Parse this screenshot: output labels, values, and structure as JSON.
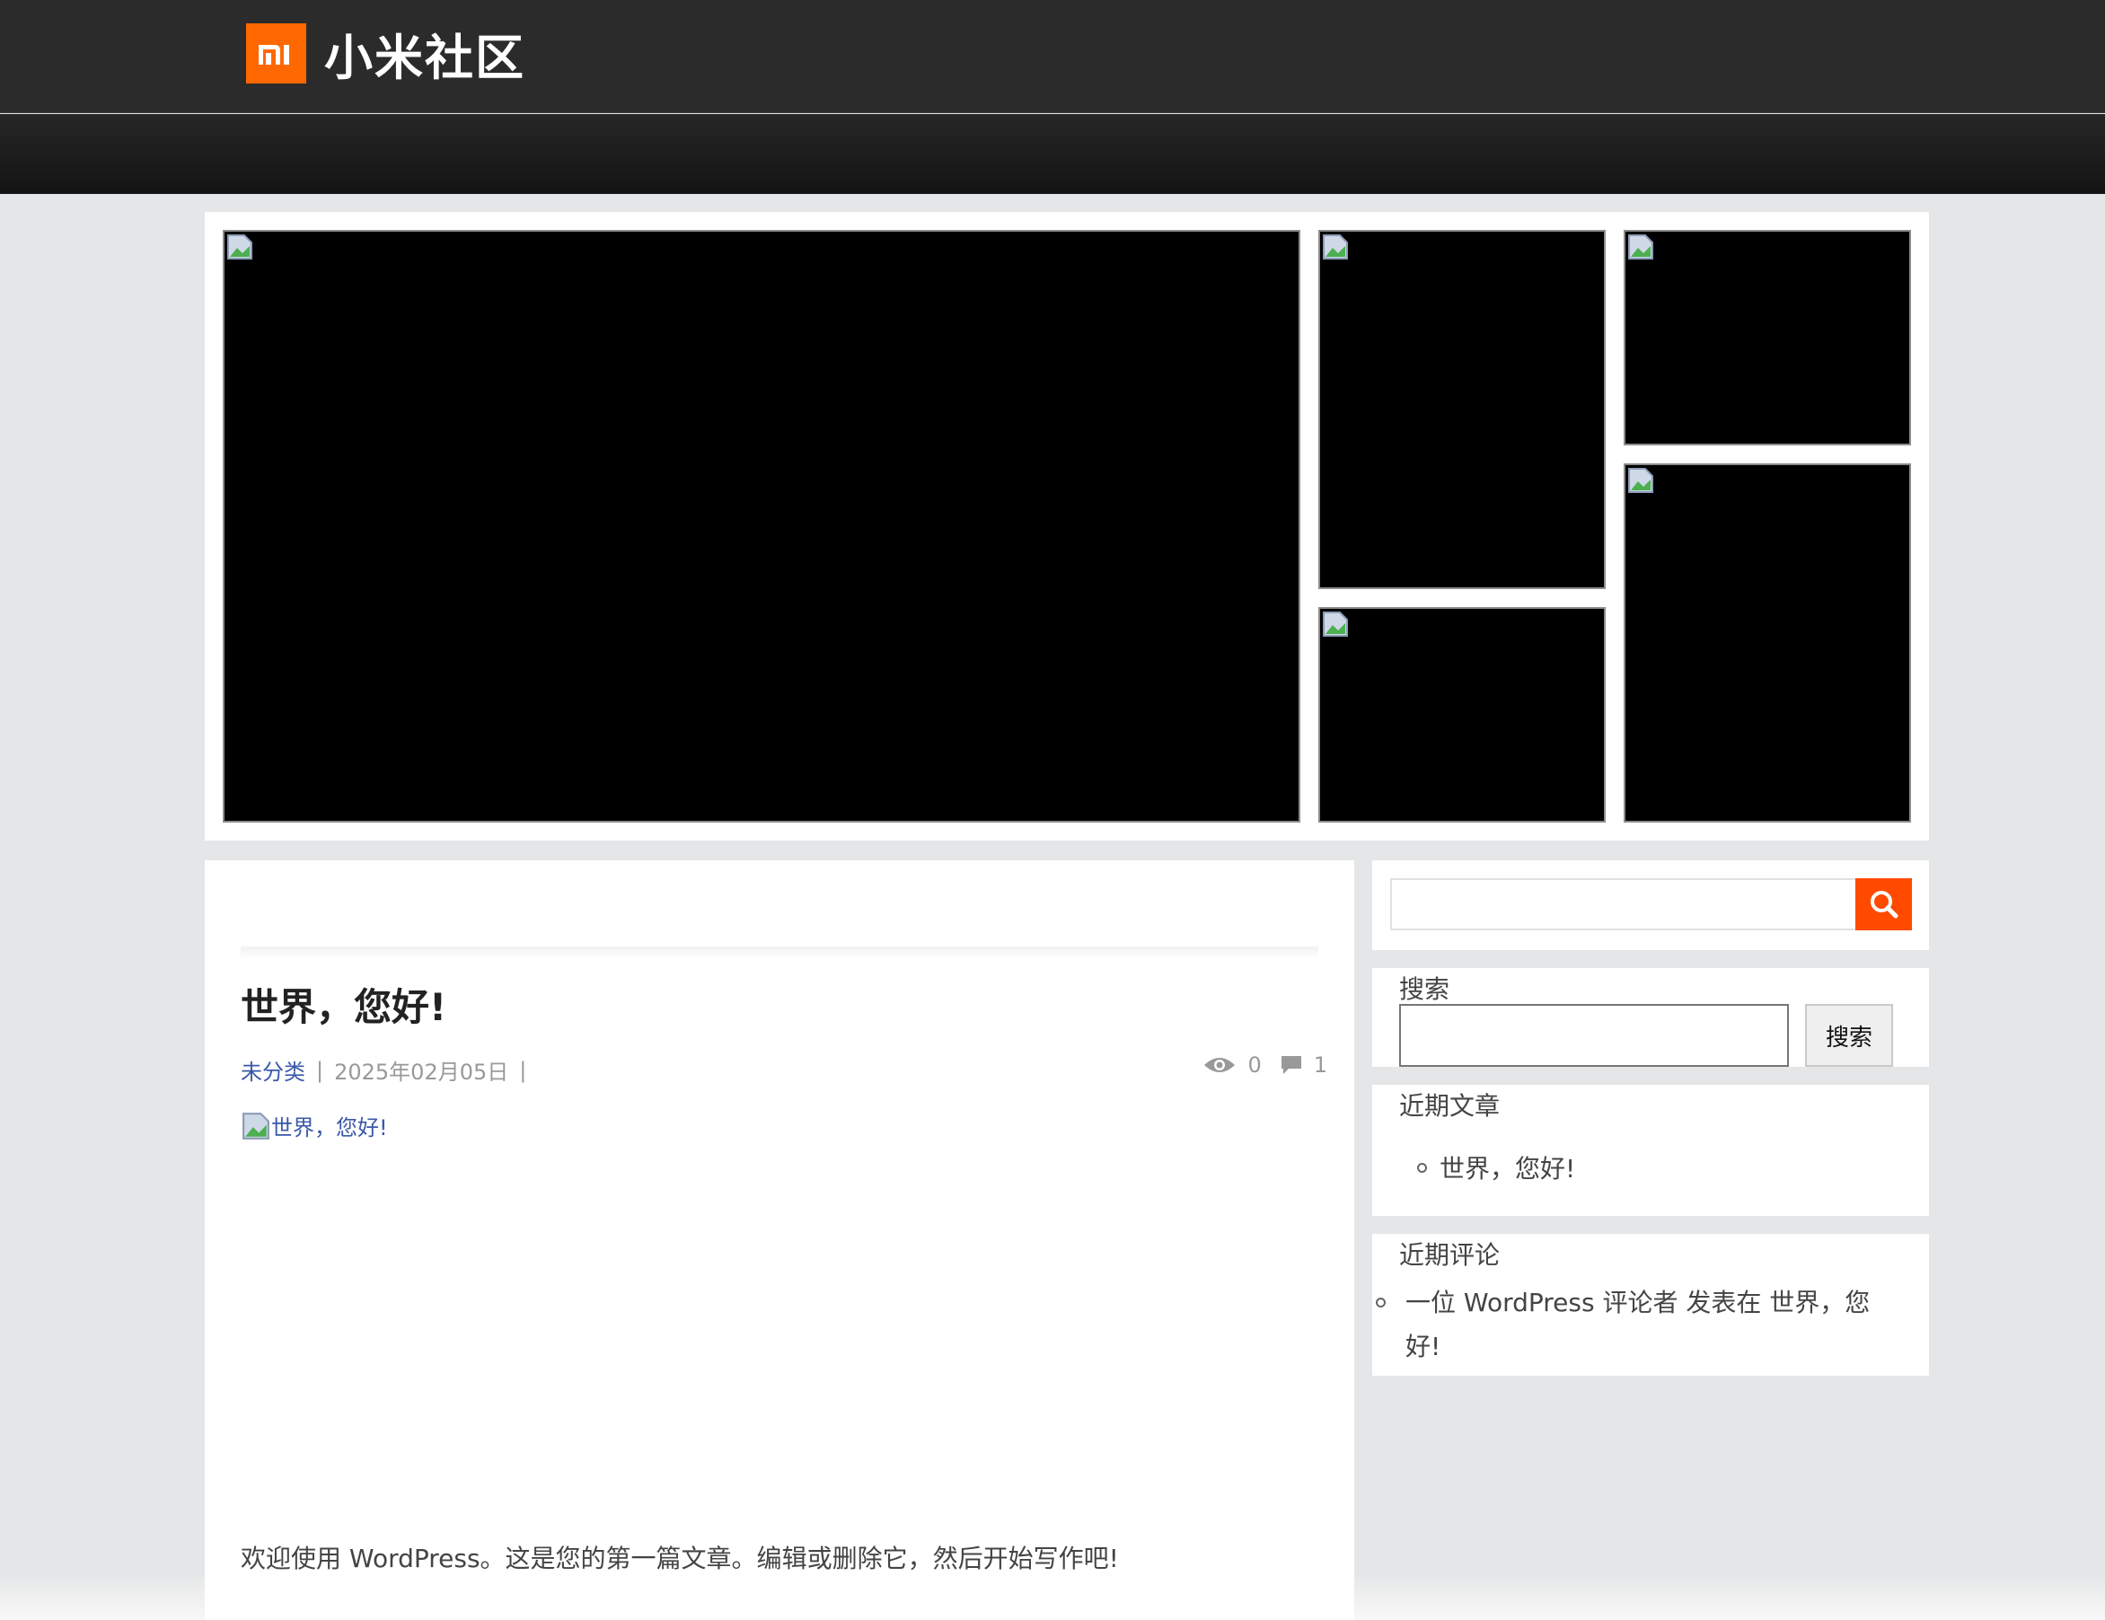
{
  "header": {
    "logo_mark": "mi",
    "site_name": "小米社区"
  },
  "featured": {
    "tiles": [
      "broken-image",
      "broken-image",
      "broken-image",
      "broken-image",
      "broken-image"
    ]
  },
  "post": {
    "title": "世界，您好!",
    "category": "未分类",
    "separator": "|",
    "date": "2025年02月05日",
    "views": "0",
    "comments": "1",
    "thumb_alt": "世界，您好!",
    "excerpt": "欢迎使用 WordPress。这是您的第一篇文章。编辑或删除它，然后开始写作吧!"
  },
  "sidebar": {
    "search_widget": {
      "title": "搜索",
      "button_label": "搜索"
    },
    "recent_posts": {
      "title": "近期文章",
      "items": [
        "世界，您好!"
      ]
    },
    "recent_comments": {
      "title": "近期评论",
      "items": [
        {
          "author": "一位 WordPress 评论者",
          "middle": "发表在",
          "post": "世界，您好!"
        }
      ]
    }
  },
  "colors": {
    "brand": "#ff6700",
    "search_button": "#ff4a00",
    "link": "#3a58a8"
  }
}
